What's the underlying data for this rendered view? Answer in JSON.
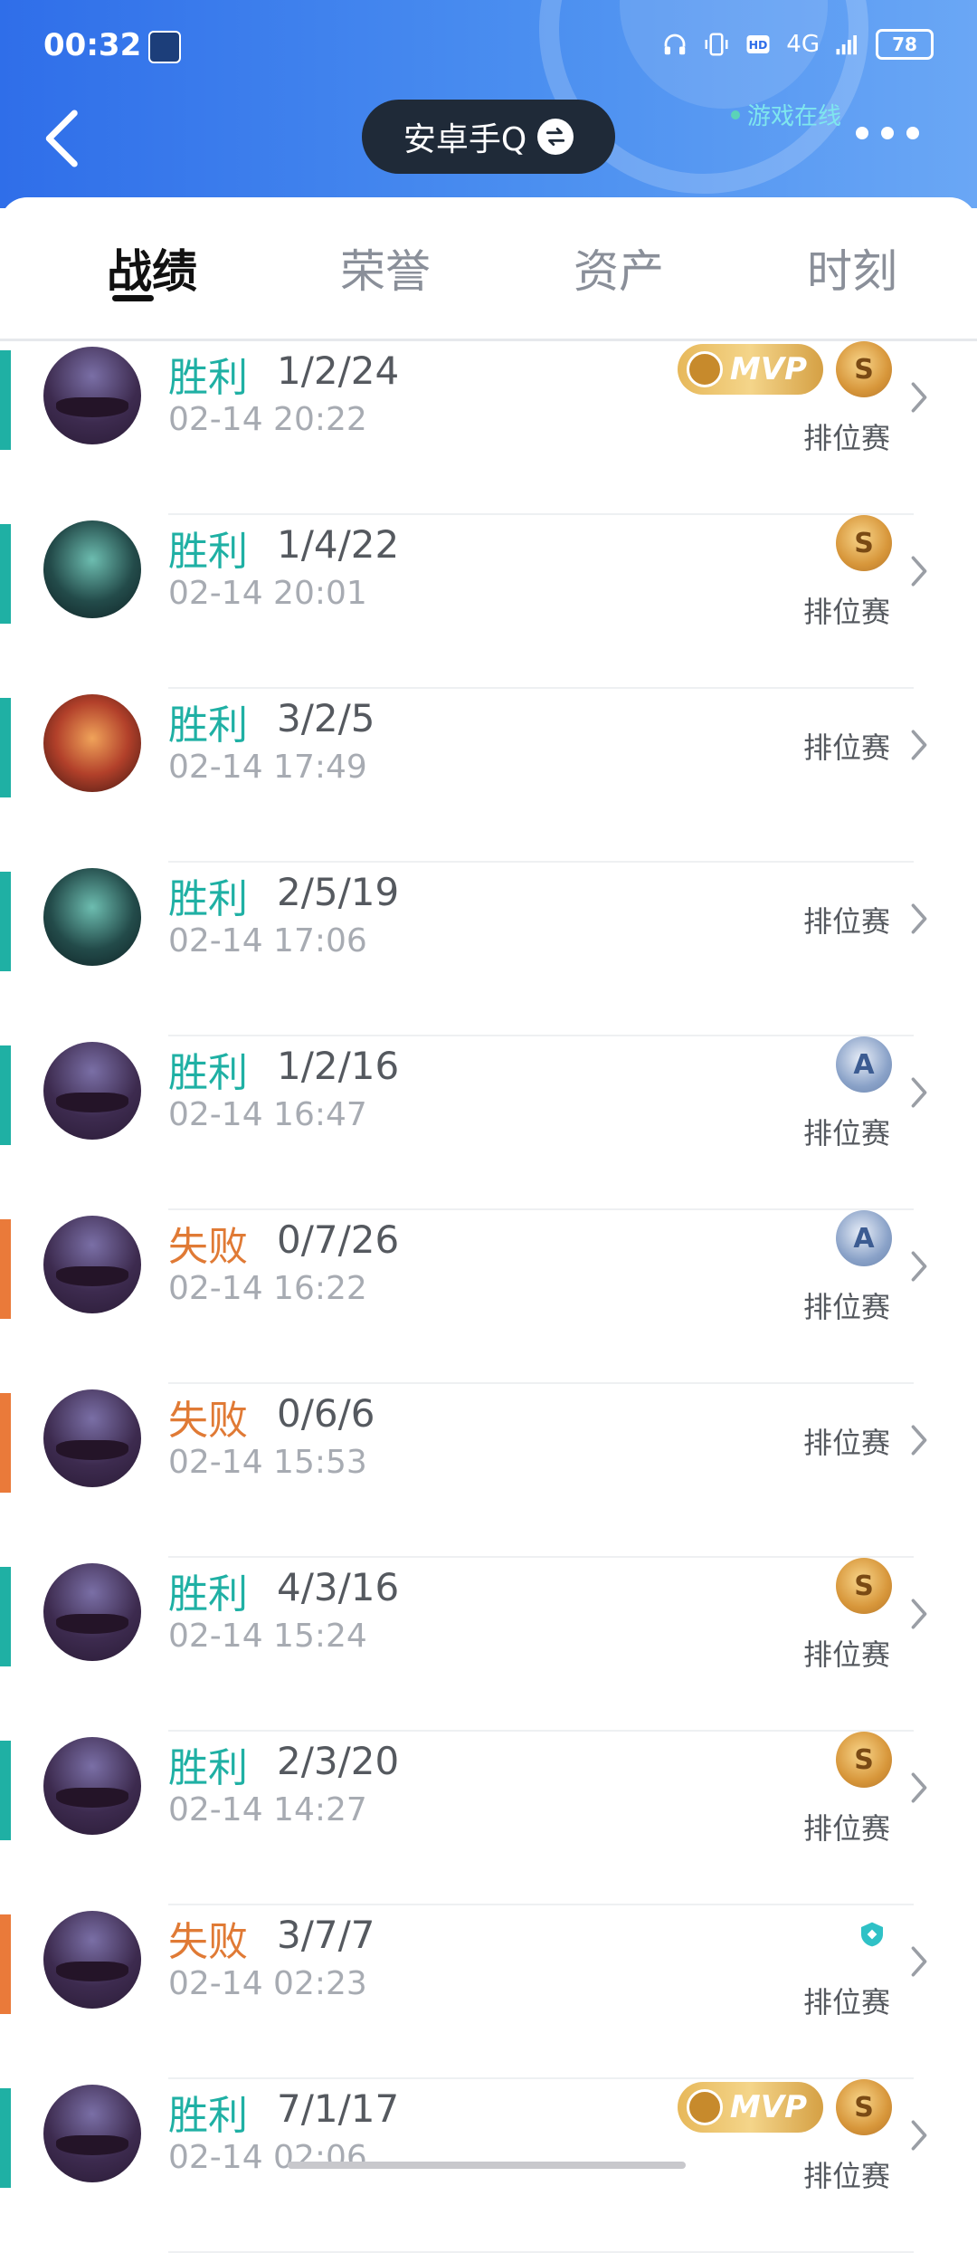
{
  "status_bar": {
    "time": "00:32",
    "network": "4G",
    "battery": "78"
  },
  "header": {
    "account_name": "安卓手Q",
    "online_status": "游戏在线"
  },
  "tabs": [
    {
      "label": "战绩",
      "active": true
    },
    {
      "label": "荣誉",
      "active": false
    },
    {
      "label": "资产",
      "active": false
    },
    {
      "label": "时刻",
      "active": false
    }
  ],
  "matches": [
    {
      "result": "胜利",
      "outcome": "win",
      "kda": "1/2/24",
      "time": "02-14 20:22",
      "mode": "排位赛",
      "mvp": true,
      "mvp_label": "MVP",
      "grade": "S",
      "avatar": "a"
    },
    {
      "result": "胜利",
      "outcome": "win",
      "kda": "1/4/22",
      "time": "02-14 20:01",
      "mode": "排位赛",
      "mvp": false,
      "grade": "S",
      "avatar": "b"
    },
    {
      "result": "胜利",
      "outcome": "win",
      "kda": "3/2/5",
      "time": "02-14 17:49",
      "mode": "排位赛",
      "mvp": false,
      "grade": "",
      "avatar": "c"
    },
    {
      "result": "胜利",
      "outcome": "win",
      "kda": "2/5/19",
      "time": "02-14 17:06",
      "mode": "排位赛",
      "mvp": false,
      "grade": "",
      "avatar": "b"
    },
    {
      "result": "胜利",
      "outcome": "win",
      "kda": "1/2/16",
      "time": "02-14 16:47",
      "mode": "排位赛",
      "mvp": false,
      "grade": "A",
      "avatar": "a"
    },
    {
      "result": "失败",
      "outcome": "loss",
      "kda": "0/7/26",
      "time": "02-14 16:22",
      "mode": "排位赛",
      "mvp": false,
      "grade": "A",
      "avatar": "a"
    },
    {
      "result": "失败",
      "outcome": "loss",
      "kda": "0/6/6",
      "time": "02-14 15:53",
      "mode": "排位赛",
      "mvp": false,
      "grade": "",
      "avatar": "a"
    },
    {
      "result": "胜利",
      "outcome": "win",
      "kda": "4/3/16",
      "time": "02-14 15:24",
      "mode": "排位赛",
      "mvp": false,
      "grade": "S",
      "avatar": "a"
    },
    {
      "result": "胜利",
      "outcome": "win",
      "kda": "2/3/20",
      "time": "02-14 14:27",
      "mode": "排位赛",
      "mvp": false,
      "grade": "S",
      "avatar": "a"
    },
    {
      "result": "失败",
      "outcome": "loss",
      "kda": "3/7/7",
      "time": "02-14 02:23",
      "mode": "排位赛",
      "mvp": false,
      "grade": "shield",
      "avatar": "a"
    },
    {
      "result": "胜利",
      "outcome": "win",
      "kda": "7/1/17",
      "time": "02-14 02:06",
      "mode": "排位赛",
      "mvp": true,
      "mvp_label": "MVP",
      "grade": "S",
      "avatar": "a"
    }
  ],
  "colors": {
    "win": "#1fb0a4",
    "loss": "#e07a35",
    "header_blue": "#2f6ee9"
  }
}
